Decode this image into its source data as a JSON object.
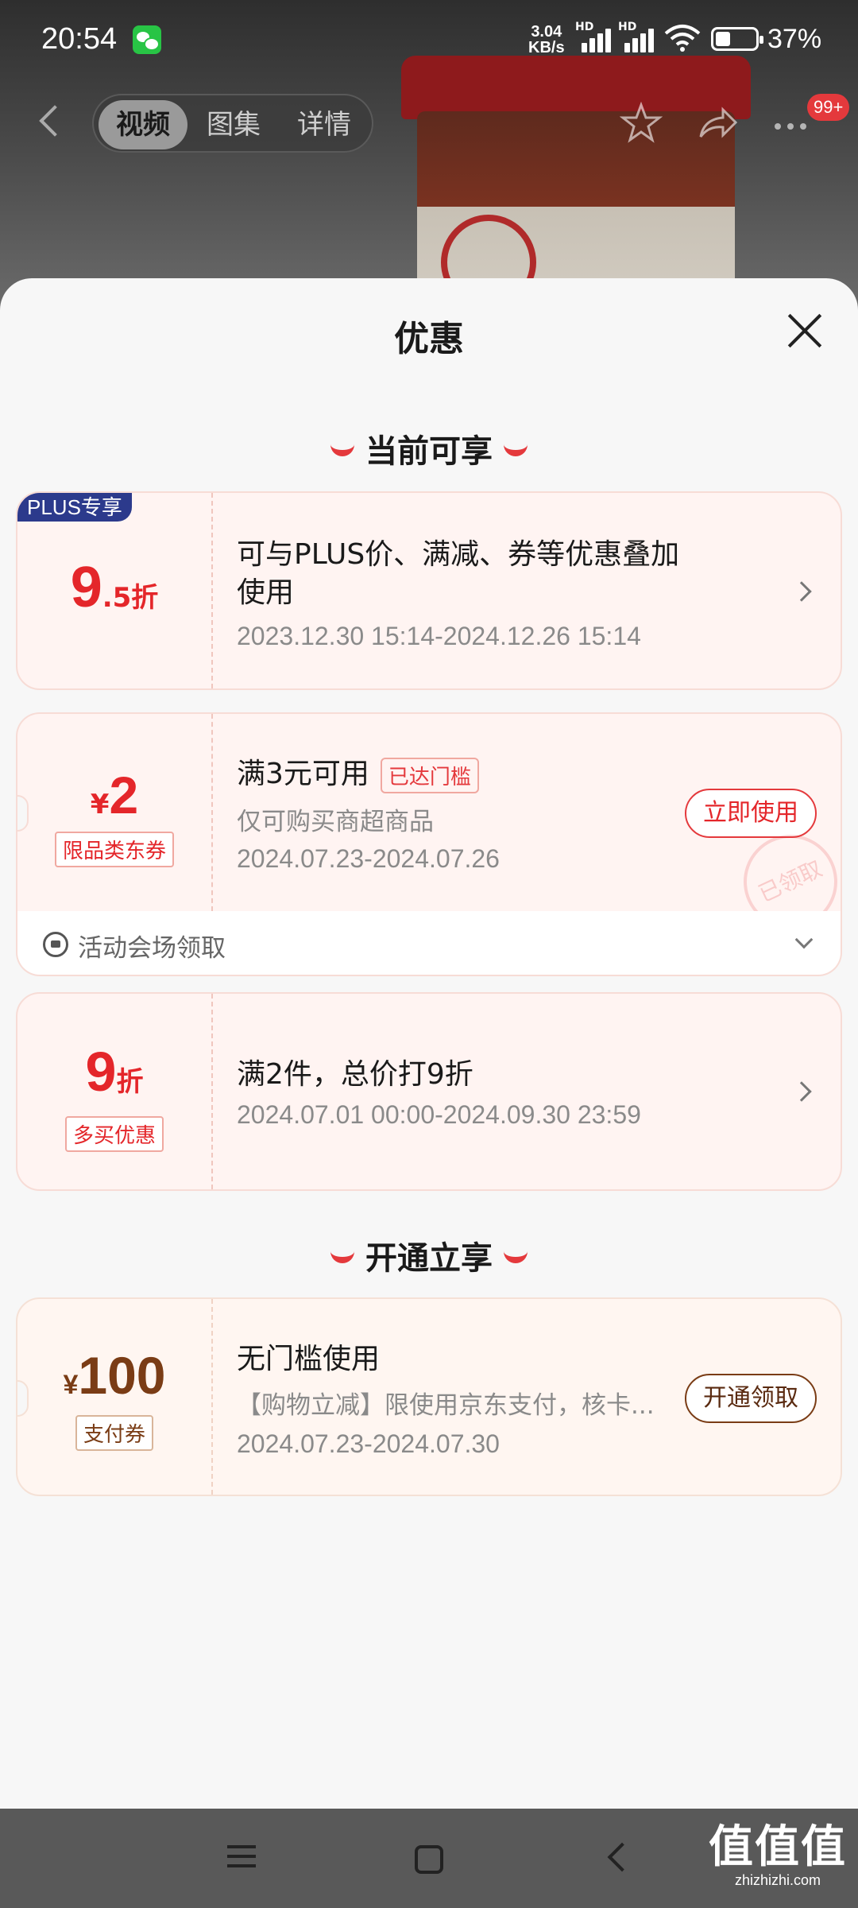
{
  "status_bar": {
    "time": "20:54",
    "net_speed_top": "3.04",
    "net_speed_bottom": "KB/s",
    "hd_label": "HD",
    "battery": "37%",
    "battery_level": 0.37
  },
  "top_nav": {
    "tabs": [
      {
        "label": "视频",
        "active": true
      },
      {
        "label": "图集",
        "active": false
      },
      {
        "label": "详情",
        "active": false
      }
    ],
    "cart_badge": "99+"
  },
  "sheet": {
    "title": "优惠",
    "section_current": "当前可享",
    "section_unlock": "开通立享",
    "cards": {
      "plus": {
        "tag": "PLUS专享",
        "discount_big": "9",
        "discount_small": ".5折",
        "desc_line1": "可与PLUS价、满减、券等优惠叠加",
        "desc_line2": "使用",
        "date": "2023.12.30 15:14-2024.12.26 15:14"
      },
      "coupon2": {
        "currency": "¥",
        "amount": "2",
        "tag": "限品类东券",
        "condition": "满3元可用",
        "reached": "已达门槛",
        "scope": "仅可购买商超商品",
        "date": "2024.07.23-2024.07.26",
        "button": "立即使用",
        "stamp": "已领取",
        "footer": "活动会场领取"
      },
      "multi": {
        "discount_big": "9",
        "discount_small": "折",
        "tag": "多买优惠",
        "desc": "满2件，总价打9折",
        "date": "2024.07.01 00:00-2024.09.30 23:59"
      },
      "pay": {
        "currency": "¥",
        "amount": "100",
        "tag": "支付券",
        "desc": "无门槛使用",
        "detail": "【购物立减】限使用京东支付，核卡...",
        "date": "2024.07.23-2024.07.30",
        "button": "开通领取"
      }
    }
  },
  "watermark": {
    "main": "值值值",
    "sub": "zhizhizhi.com"
  },
  "colors": {
    "accent_red": "#e4262a",
    "plus_blue": "#2c3a8c",
    "gold_brown": "#7a3c15",
    "sheet_bg": "#f7f7f7"
  }
}
